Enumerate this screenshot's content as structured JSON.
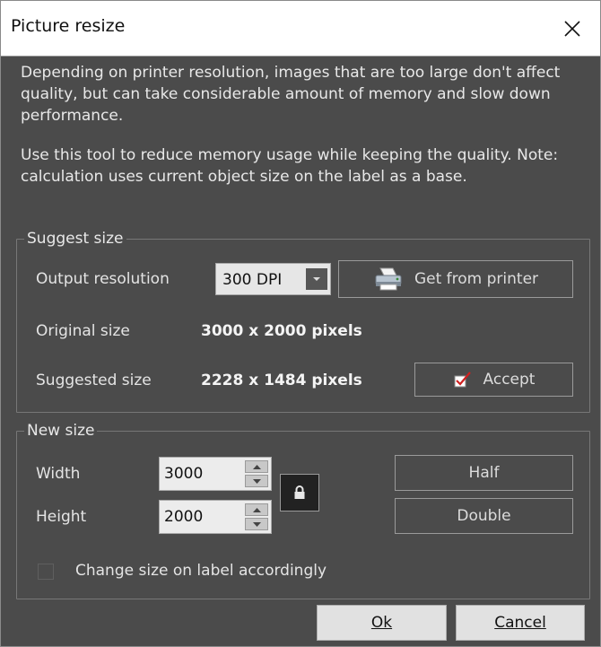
{
  "window": {
    "title": "Picture resize"
  },
  "description": {
    "p1": "Depending on printer resolution, images that are too large don't affect quality, but can take considerable amount of memory and slow down performance.",
    "p2": "Use this tool to reduce memory usage while keeping the quality. Note: calculation uses current object size on the label as a base."
  },
  "suggest": {
    "legend": "Suggest size",
    "output_resolution_label": "Output resolution",
    "resolution_value": "300 DPI",
    "get_from_printer_label": "Get from printer",
    "original_size_label": "Original size",
    "original_size_value": "3000 x 2000 pixels",
    "suggested_size_label": "Suggested size",
    "suggested_size_value": "2228 x 1484 pixels",
    "accept_label": "Accept"
  },
  "newsize": {
    "legend": "New size",
    "width_label": "Width",
    "width_value": "3000",
    "height_label": "Height",
    "height_value": "2000",
    "half_label": "Half",
    "double_label": "Double",
    "change_size_label": "Change size on label accordingly"
  },
  "footer": {
    "ok_label": "Ok",
    "cancel_label": "Cancel"
  },
  "colors": {
    "background": "#4b4b4b",
    "titlebar": "#ffffff",
    "text": "#e4e4e4",
    "accept_check": "#d02020"
  },
  "icons": {
    "close": "close-icon",
    "dropdown": "chevron-down-icon",
    "printer": "printer-icon",
    "accept": "checkbox-checked-icon",
    "lock": "lock-icon",
    "spin_up": "arrow-up-icon",
    "spin_down": "arrow-down-icon"
  }
}
